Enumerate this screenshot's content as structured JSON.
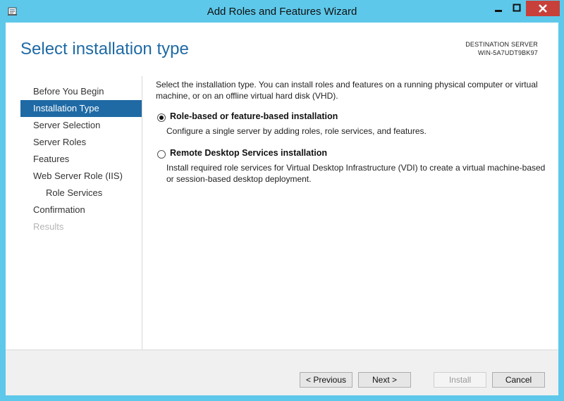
{
  "window": {
    "title": "Add Roles and Features Wizard",
    "controls": [
      "minimize-icon",
      "maximize-icon",
      "close-icon"
    ],
    "accent": "#5ec8ea",
    "close_color": "#c7413a"
  },
  "header": {
    "page_title": "Select installation type",
    "destination_label": "DESTINATION SERVER",
    "destination_name": "WIN-5A7UDT9BK97"
  },
  "nav": {
    "items": [
      {
        "label": "Before You Begin",
        "state": "normal"
      },
      {
        "label": "Installation Type",
        "state": "active"
      },
      {
        "label": "Server Selection",
        "state": "normal"
      },
      {
        "label": "Server Roles",
        "state": "normal"
      },
      {
        "label": "Features",
        "state": "normal"
      },
      {
        "label": "Web Server Role (IIS)",
        "state": "normal"
      },
      {
        "label": "Role Services",
        "state": "sub"
      },
      {
        "label": "Confirmation",
        "state": "normal"
      },
      {
        "label": "Results",
        "state": "disabled"
      }
    ],
    "active_color": "#1f6aa5"
  },
  "content": {
    "intro": "Select the installation type. You can install roles and features on a running physical computer or virtual machine, or on an offline virtual hard disk (VHD).",
    "options": [
      {
        "title": "Role-based or feature-based installation",
        "description": "Configure a single server by adding roles, role services, and features.",
        "selected": true
      },
      {
        "title": "Remote Desktop Services installation",
        "description": "Install required role services for Virtual Desktop Infrastructure (VDI) to create a virtual machine-based or session-based desktop deployment.",
        "selected": false
      }
    ]
  },
  "footer": {
    "previous": "< Previous",
    "next": "Next >",
    "install": "Install",
    "cancel": "Cancel"
  }
}
